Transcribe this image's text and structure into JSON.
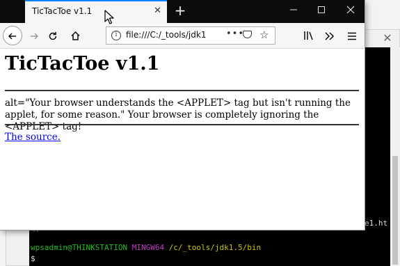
{
  "browser": {
    "tab_title": "TicTacToe v1.1",
    "tab_close": "✕",
    "new_tab": "+",
    "url": "file:///C:/_tools/jdk1",
    "more": "•••"
  },
  "page": {
    "heading": "TicTacToe v1.1",
    "alt_text": "alt=\"Your browser understands the <APPLET> tag but isn't running the applet, for some reason.\" Your browser is completely ignoring the <APPLET> tag!",
    "source_link": "The source."
  },
  "terminal": {
    "right_text": "e1.ht",
    "tick_marks": "\"\"",
    "prompt_user": "wpsadmin@THINKSTATION",
    "prompt_env": "MINGW64",
    "prompt_path": "/c/_tools/jdk1.5/bin",
    "dollar": "$",
    "close": "✕"
  },
  "colors": {
    "tab_accent": "#0a84ff",
    "tabbar_bg": "#0c0c0d",
    "link": "#0000ee",
    "prompt_user": "#20c020",
    "prompt_env": "#c040c0",
    "prompt_path": "#c8c800"
  },
  "icons": [
    "back-arrow-icon",
    "forward-arrow-icon",
    "reload-icon",
    "home-icon",
    "info-icon",
    "pocket-icon",
    "star-icon",
    "library-icon",
    "overflow-icon",
    "hamburger-menu-icon",
    "mouse-cursor-icon"
  ]
}
